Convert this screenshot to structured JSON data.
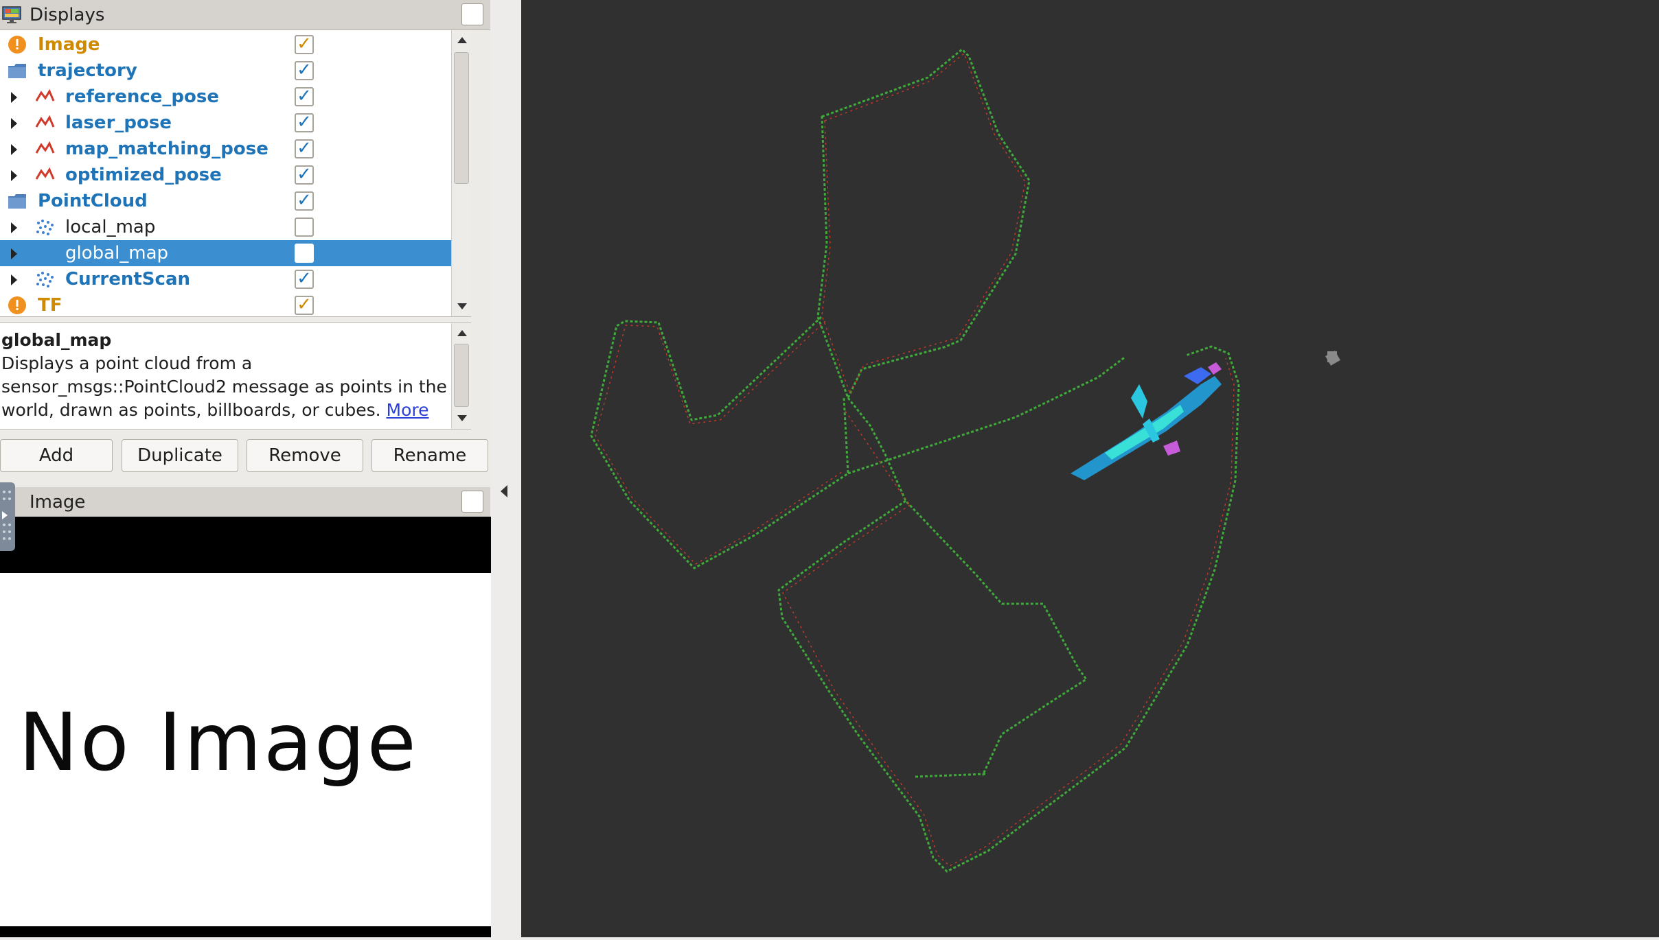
{
  "displays_panel": {
    "title": "Displays",
    "items": [
      {
        "label": "Image",
        "type": "warning",
        "checked": true,
        "icon": "warning-icon"
      },
      {
        "label": "trajectory",
        "type": "group",
        "checked": true,
        "icon": "folder-icon"
      },
      {
        "label": "reference_pose",
        "type": "path",
        "checked": true,
        "icon": "path-icon"
      },
      {
        "label": "laser_pose",
        "type": "path",
        "checked": true,
        "icon": "path-icon"
      },
      {
        "label": "map_matching_pose",
        "type": "path",
        "checked": true,
        "icon": "path-icon"
      },
      {
        "label": "optimized_pose",
        "type": "path",
        "checked": true,
        "icon": "path-icon"
      },
      {
        "label": "PointCloud",
        "type": "group",
        "checked": true,
        "icon": "folder-icon"
      },
      {
        "label": "local_map",
        "type": "cloud",
        "checked": false,
        "icon": "pointcloud-icon"
      },
      {
        "label": "global_map",
        "type": "cloud",
        "checked": false,
        "selected": true,
        "icon": "pointcloud-icon"
      },
      {
        "label": "CurrentScan",
        "type": "cloud",
        "checked": true,
        "icon": "pointcloud-icon"
      },
      {
        "label": "TF",
        "type": "warning",
        "checked": true,
        "icon": "warning-icon"
      }
    ]
  },
  "description": {
    "title": "global_map",
    "text": "Displays a point cloud from a sensor_msgs::PointCloud2 message as points in the world, drawn as points, billboards, or cubes.",
    "link": "More"
  },
  "buttons": {
    "add": "Add",
    "duplicate": "Duplicate",
    "remove": "Remove",
    "rename": "Rename"
  },
  "image_panel": {
    "title": "Image",
    "placeholder": "No Image"
  },
  "colors": {
    "viewport_bg": "#303030",
    "selection": "#3b8fd0",
    "active_label": "#1f73b7",
    "warning": "#d08a00"
  }
}
